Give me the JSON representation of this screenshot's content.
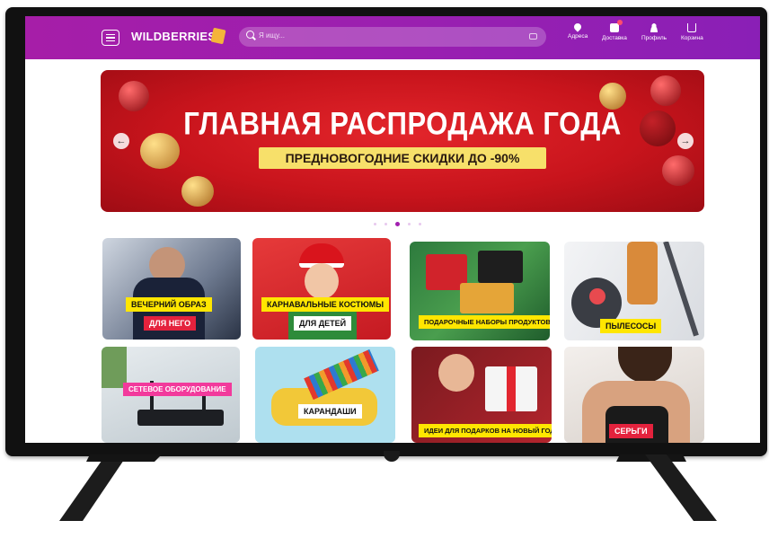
{
  "header": {
    "logo": "WILDBERRIES",
    "search_placeholder": "Я ищу...",
    "nav": [
      {
        "label": "Адреса",
        "icon": "location-pin-icon"
      },
      {
        "label": "Доставка",
        "icon": "delivery-box-icon"
      },
      {
        "label": "Профиль",
        "icon": "user-icon"
      },
      {
        "label": "Корзина",
        "icon": "cart-icon"
      }
    ]
  },
  "banner": {
    "title": "ГЛАВНАЯ РАСПРОДАЖА ГОДА",
    "subtitle": "ПРЕДНОВОГОДНИЕ СКИДКИ ДО -90%",
    "prev_icon": "chevron-left-icon",
    "next_icon": "chevron-right-icon",
    "slides": 5,
    "active_slide": 3
  },
  "categories": [
    {
      "labels": [
        "ВЕЧЕРНИЙ ОБРАЗ",
        "ДЛЯ НЕГО"
      ]
    },
    {
      "labels": [
        "КАРНАВАЛЬНЫЕ КОСТЮМЫ",
        "ДЛЯ ДЕТЕЙ"
      ]
    },
    {
      "labels": [
        "ПОДАРОЧНЫЕ НАБОРЫ ПРОДУКТОВ"
      ]
    },
    {
      "labels": [
        "ПЫЛЕСОСЫ"
      ]
    },
    {
      "labels": [
        "СЕТЕВОЕ ОБОРУДОВАНИЕ"
      ]
    },
    {
      "labels": [
        "КАРАНДАШИ"
      ]
    },
    {
      "labels": [
        "ИДЕИ ДЛЯ ПОДАРКОВ НА НОВЫЙ ГОД"
      ]
    },
    {
      "labels": [
        "СЕРЬГИ"
      ]
    }
  ],
  "colors": {
    "brand": "#a21fb0",
    "banner": "#d41c22",
    "accent_yellow": "#ffe600",
    "accent_pink": "#f23a9c"
  }
}
